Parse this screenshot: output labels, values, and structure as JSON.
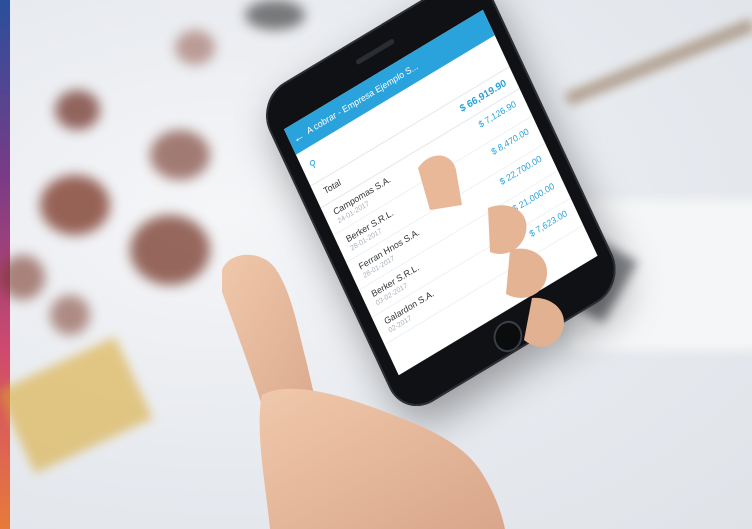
{
  "app": {
    "title": "A cobrar - Empresa Ejemplo S...",
    "back_icon": "arrow-left-icon",
    "search_icon": "search-icon",
    "total_label": "Total",
    "total_amount": "$ 66,919.90",
    "accent_color": "#2aa3dc"
  },
  "items": [
    {
      "name": "Campomas S.A.",
      "date": "24-01-2017",
      "amount": "$ 7,126.90"
    },
    {
      "name": "Berker S.R.L.",
      "date": "28-01-2017",
      "amount": "$ 8,470.00"
    },
    {
      "name": "Ferran Hnos S.A.",
      "date": "28-01-2017",
      "amount": "$ 22,700.00"
    },
    {
      "name": "Berker S.R.L.",
      "date": "03-02-2017",
      "amount": "$ 21,000.00"
    },
    {
      "name": "Galardon S.A.",
      "date": "02-2017",
      "amount": "$ 7,623.00"
    }
  ]
}
